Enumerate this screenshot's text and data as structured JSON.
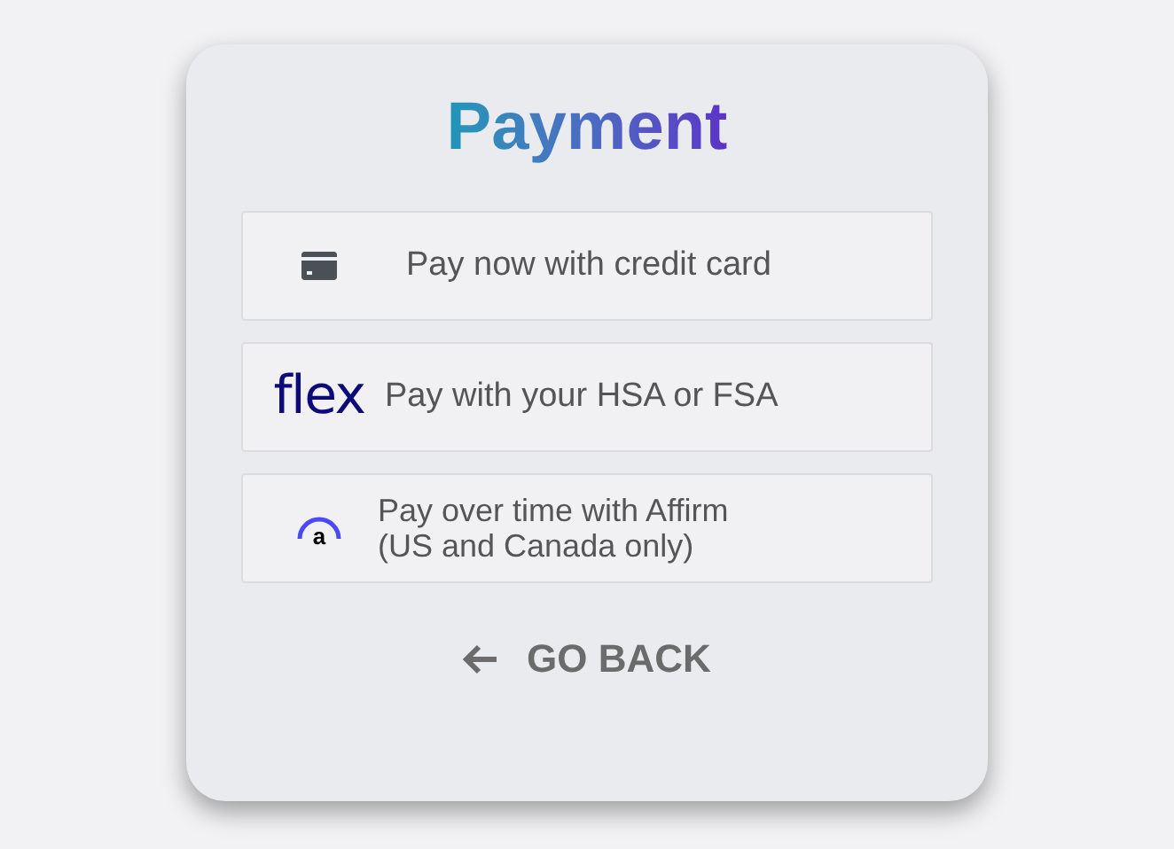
{
  "title": "Payment",
  "options": [
    {
      "kind": "card",
      "label": "Pay now with credit card"
    },
    {
      "kind": "flex",
      "logo": "flex",
      "label": "Pay with your HSA or FSA"
    },
    {
      "kind": "affirm",
      "logo": "a",
      "lines": [
        "Pay over time with Affirm",
        "(US and Canada only)"
      ]
    }
  ],
  "back": {
    "label": "GO BACK"
  }
}
